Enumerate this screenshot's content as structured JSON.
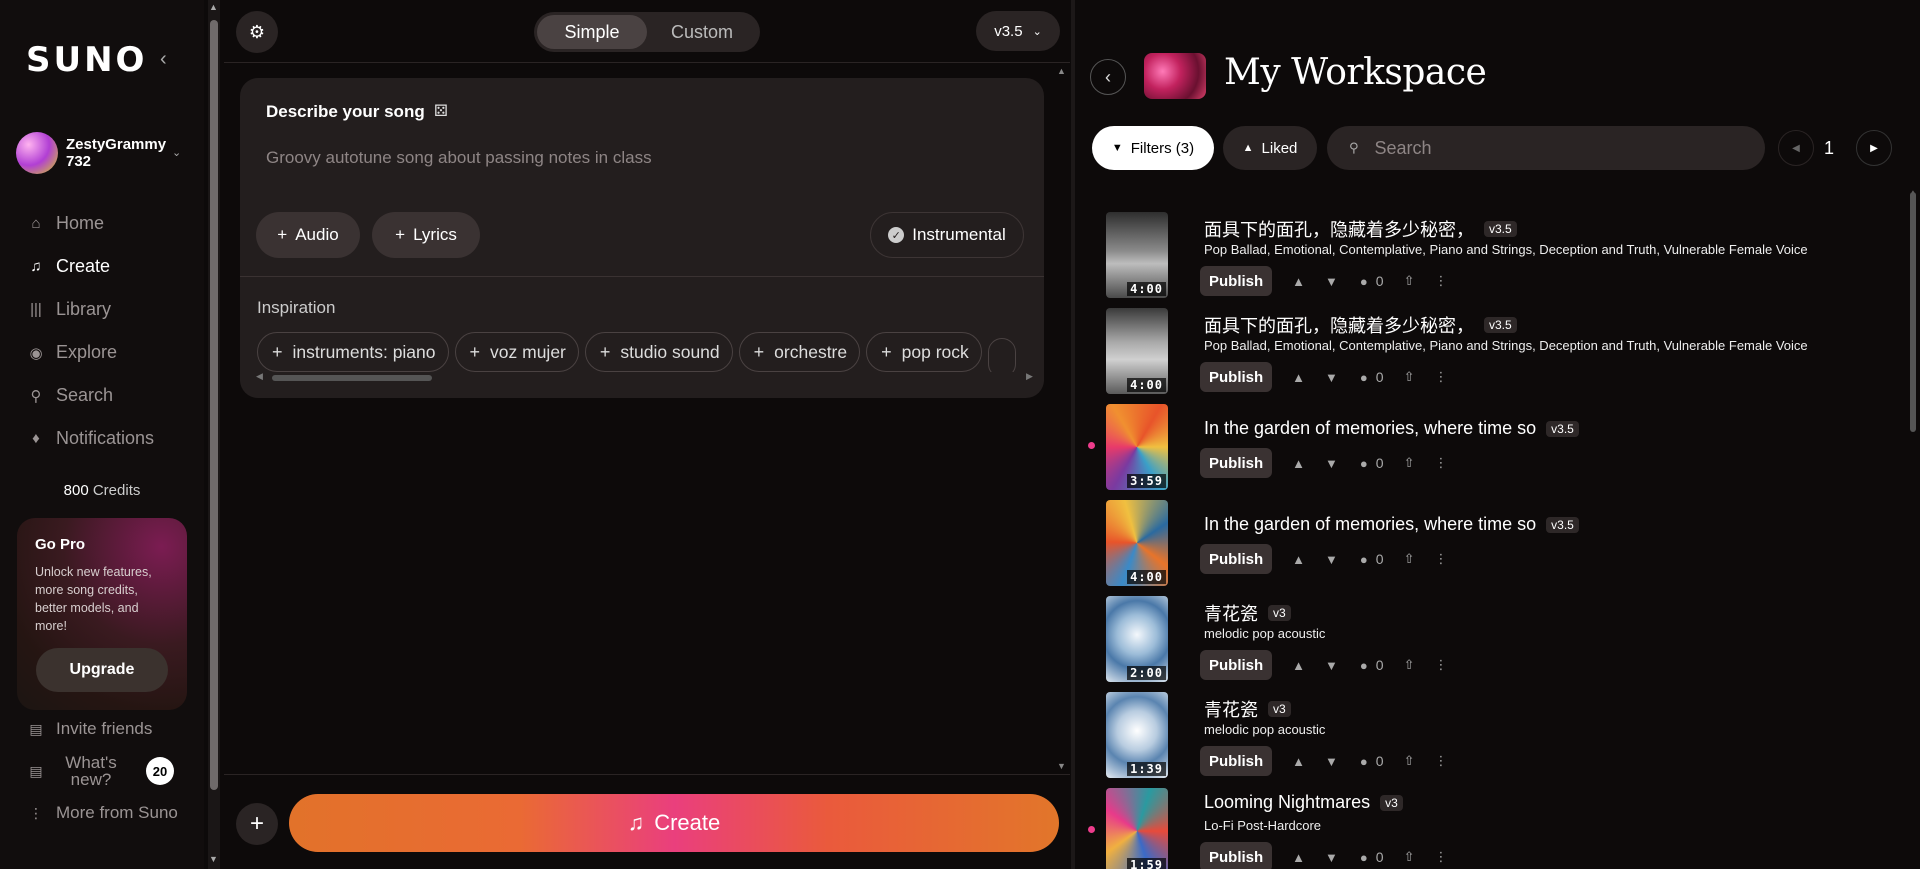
{
  "sidebar": {
    "logo": "SUNO",
    "user": {
      "name": "ZestyGrammy 732"
    },
    "nav": [
      {
        "label": "Home",
        "icon": "home-icon",
        "active": false
      },
      {
        "label": "Create",
        "icon": "music-note-icon",
        "active": true
      },
      {
        "label": "Library",
        "icon": "library-icon",
        "active": false
      },
      {
        "label": "Explore",
        "icon": "compass-icon",
        "active": false
      },
      {
        "label": "Search",
        "icon": "search-icon",
        "active": false
      },
      {
        "label": "Notifications",
        "icon": "bell-icon",
        "active": false
      }
    ],
    "credits_num": "800",
    "credits_label": "Credits",
    "gopro": {
      "title": "Go Pro",
      "text": "Unlock new features, more song credits, better models, and more!",
      "button": "Upgrade"
    },
    "invite": "Invite friends",
    "whats_new": "What's new?",
    "whats_new_count": "20",
    "more": "More from Suno"
  },
  "create_panel": {
    "modes": [
      "Simple",
      "Custom"
    ],
    "active_mode": "Simple",
    "version": "v3.5",
    "describe_title": "Describe your song",
    "describe_placeholder": "Groovy autotune song about passing notes in class",
    "audio_label": "Audio",
    "lyrics_label": "Lyrics",
    "instrumental_label": "Instrumental",
    "inspiration_title": "Inspiration",
    "chips": [
      "instruments: piano",
      "voz mujer",
      "studio sound",
      "orchestre",
      "pop rock"
    ],
    "create_label": "Create"
  },
  "workspace": {
    "title": "My Workspace",
    "filters_label": "Filters (3)",
    "liked_label": "Liked",
    "search_placeholder": "Search",
    "page": "1",
    "publish_label": "Publish",
    "songs": [
      {
        "title": "面具下的面孔，隐藏着多少秘密，",
        "version": "v3.5",
        "tags": "Pop Ballad, Emotional, Contemplative, Piano and Strings, Deception and Truth, Vulnerable Female Voice",
        "duration": "4:00",
        "comments": "0",
        "dot": false
      },
      {
        "title": "面具下的面孔，隐藏着多少秘密，",
        "version": "v3.5",
        "tags": "Pop Ballad, Emotional, Contemplative, Piano and Strings, Deception and Truth, Vulnerable Female Voice",
        "duration": "4:00",
        "comments": "0",
        "dot": false
      },
      {
        "title": "In the garden of memories, where time so",
        "version": "v3.5",
        "tags": "",
        "duration": "3:59",
        "comments": "0",
        "dot": true
      },
      {
        "title": "In the garden of memories, where time so",
        "version": "v3.5",
        "tags": "",
        "duration": "4:00",
        "comments": "0",
        "dot": false
      },
      {
        "title": "青花瓷",
        "version": "v3",
        "tags": "melodic pop acoustic",
        "duration": "2:00",
        "comments": "0",
        "dot": false
      },
      {
        "title": "青花瓷",
        "version": "v3",
        "tags": "melodic pop acoustic",
        "duration": "1:39",
        "comments": "0",
        "dot": false
      },
      {
        "title": "Looming Nightmares",
        "version": "v3",
        "tags": "Lo-Fi Post-Hardcore",
        "duration": "1:59",
        "comments": "0",
        "dot": true
      }
    ]
  }
}
